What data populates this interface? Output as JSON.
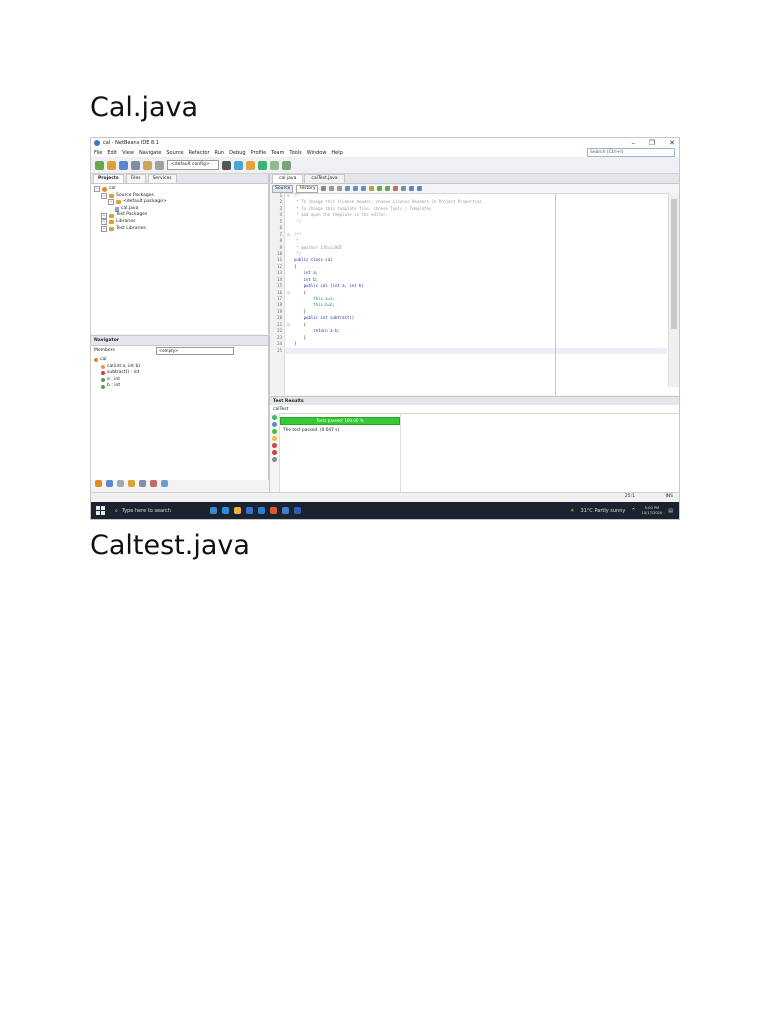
{
  "headings": {
    "first": "Cal.java",
    "second": "Caltest.java"
  },
  "ide": {
    "window_title": "cal - NetBeans IDE 8.1",
    "window_controls": [
      "–",
      "❐",
      "✕"
    ],
    "menu": [
      "File",
      "Edit",
      "View",
      "Navigate",
      "Source",
      "Refactor",
      "Run",
      "Debug",
      "Profile",
      "Team",
      "Tools",
      "Window",
      "Help"
    ],
    "search_placeholder": "Search (Ctrl+I)",
    "config_select": "<default config>",
    "projects": {
      "tabs": [
        "Projects",
        "Files",
        "Services"
      ],
      "tree": [
        {
          "label": "cal",
          "icon": "cup",
          "indent": 0
        },
        {
          "label": "Source Packages",
          "icon": "pkg",
          "indent": 1
        },
        {
          "label": "<default package>",
          "icon": "pkg",
          "indent": 2
        },
        {
          "label": "cal.java",
          "icon": "fil",
          "indent": 3
        },
        {
          "label": "Test Packages",
          "icon": "pkg",
          "indent": 1
        },
        {
          "label": "Libraries",
          "icon": "pkg",
          "indent": 1
        },
        {
          "label": "Test Libraries",
          "icon": "pkg",
          "indent": 1
        }
      ]
    },
    "navigator": {
      "title": "Navigator",
      "members_label": "Members",
      "filter_value": "<empty>",
      "items": [
        {
          "label": "cal",
          "icon": "#e08b2a",
          "indent": 0
        },
        {
          "label": "cal(int a, int b)",
          "icon": "#e0a040",
          "indent": 1
        },
        {
          "label": "subtract() : int",
          "icon": "#d04040",
          "indent": 1
        },
        {
          "label": "a : int",
          "icon": "#5a9a5a",
          "indent": 1
        },
        {
          "label": "b : int",
          "icon": "#5a9a5a",
          "indent": 1
        }
      ]
    },
    "editor": {
      "tabs": [
        "cal.java",
        "calTest.java"
      ],
      "modes": [
        "Source",
        "History"
      ],
      "lines": [
        {
          "n": "1",
          "fold": "⊟",
          "cls": "c-cmt",
          "text": "/*"
        },
        {
          "n": "2",
          "fold": "",
          "cls": "c-cmt",
          "text": " * To change this license header, choose License Headers in Project Properties."
        },
        {
          "n": "3",
          "fold": "",
          "cls": "c-cmt",
          "text": " * To change this template file, choose Tools | Templates"
        },
        {
          "n": "4",
          "fold": "",
          "cls": "c-cmt",
          "text": " * and open the template in the editor."
        },
        {
          "n": "5",
          "fold": "",
          "cls": "c-cmt",
          "text": " */"
        },
        {
          "n": "6",
          "fold": "",
          "cls": "",
          "text": ""
        },
        {
          "n": "7",
          "fold": "⊟",
          "cls": "c-cmt",
          "text": "/**"
        },
        {
          "n": "8",
          "fold": "",
          "cls": "c-cmt",
          "text": " *"
        },
        {
          "n": "9",
          "fold": "",
          "cls": "c-cmt",
          "text": " * @author 17bcs2805"
        },
        {
          "n": "10",
          "fold": "",
          "cls": "c-cmt",
          "text": " */"
        },
        {
          "n": "11",
          "fold": "",
          "cls": "c-kw",
          "text": "public class cal"
        },
        {
          "n": "12",
          "fold": "",
          "cls": "",
          "text": "{"
        },
        {
          "n": "13",
          "fold": "",
          "cls": "c-kw",
          "text": "    int a;"
        },
        {
          "n": "14",
          "fold": "",
          "cls": "c-kw",
          "text": "    int b;"
        },
        {
          "n": "15",
          "fold": "",
          "cls": "c-kw",
          "text": "    public cal (int a, int b)"
        },
        {
          "n": "16",
          "fold": "⊟",
          "cls": "",
          "text": "    {"
        },
        {
          "n": "17",
          "fold": "",
          "cls": "c-fld",
          "text": "        this.a=a;"
        },
        {
          "n": "18",
          "fold": "",
          "cls": "c-fld",
          "text": "        this.b=b;"
        },
        {
          "n": "19",
          "fold": "",
          "cls": "",
          "text": "    }"
        },
        {
          "n": "20",
          "fold": "",
          "cls": "c-kw",
          "text": "    public int subtract()"
        },
        {
          "n": "21",
          "fold": "⊟",
          "cls": "",
          "text": "    {"
        },
        {
          "n": "22",
          "fold": "",
          "cls": "c-kw",
          "text": "        return a-b;"
        },
        {
          "n": "23",
          "fold": "",
          "cls": "",
          "text": "    }"
        },
        {
          "n": "24",
          "fold": "",
          "cls": "",
          "text": "}"
        },
        {
          "n": "25",
          "fold": "",
          "cls": "",
          "text": ""
        }
      ]
    },
    "test_results": {
      "title": "Test Results",
      "subtab": "calTest",
      "progress_label": "Tests passed: 100.00 %",
      "progress_fraction": 1.0,
      "message": "The test passed. (0.047 s)"
    },
    "status": {
      "caret": "25:1",
      "mode": "INS"
    },
    "taskbar": {
      "search_placeholder": "Type here to search",
      "weather": "31°C  Partly sunny",
      "time": "5:00 PM",
      "date": "10/17/2020"
    },
    "colors": {
      "accent": "#3b78c2",
      "pass": "#35c935",
      "taskbar": "#1c2330"
    }
  }
}
